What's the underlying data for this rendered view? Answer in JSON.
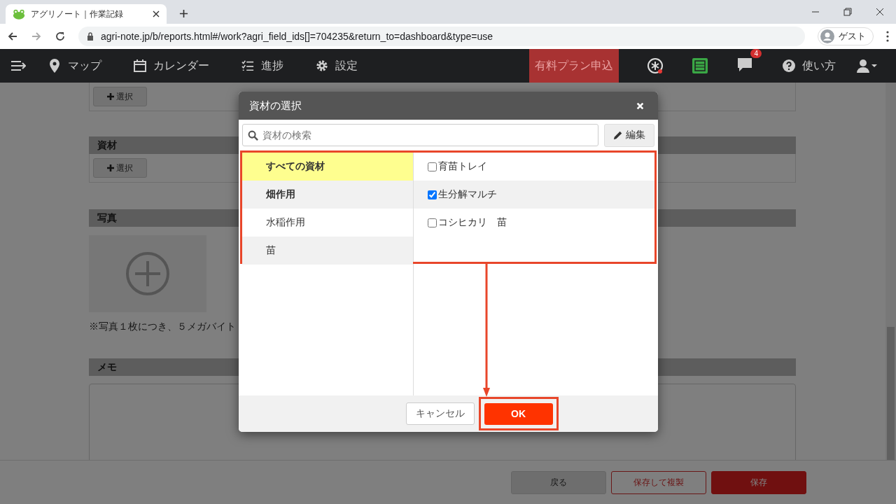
{
  "browser": {
    "tab_title": "アグリノート｜作業記録",
    "url": "agri-note.jp/b/reports.html#/work?agri_field_ids[]=704235&return_to=dashboard&type=use",
    "profile": "ゲスト"
  },
  "nav": {
    "map": "マップ",
    "calendar": "カレンダー",
    "progress": "進捗",
    "settings": "設定",
    "plan_button": "有料プラン申込",
    "message_count": "4",
    "help": "使い方"
  },
  "page": {
    "select_button_top": "選択",
    "material_header": "資材",
    "material_select_button": "選択",
    "photo_header": "写真",
    "photo_note": "※写真１枚につき、５メガバイト",
    "memo_header": "メモ"
  },
  "footer": {
    "back": "戻る",
    "save_copy": "保存して複製",
    "save": "保存"
  },
  "modal": {
    "title": "資材の選択",
    "search_placeholder": "資材の検索",
    "edit_button": "編集",
    "categories": [
      {
        "label": "すべての資材",
        "selected": true,
        "bold": true
      },
      {
        "label": "畑作用",
        "selected": false,
        "bold": true
      },
      {
        "label": "水稲作用",
        "selected": false,
        "bold": false
      },
      {
        "label": "苗",
        "selected": false,
        "bold": false
      }
    ],
    "materials": [
      {
        "label": "育苗トレイ",
        "checked": false
      },
      {
        "label": "生分解マルチ",
        "checked": true
      },
      {
        "label": "コシヒカリ　苗",
        "checked": false
      }
    ],
    "cancel": "キャンセル",
    "ok": "OK"
  }
}
